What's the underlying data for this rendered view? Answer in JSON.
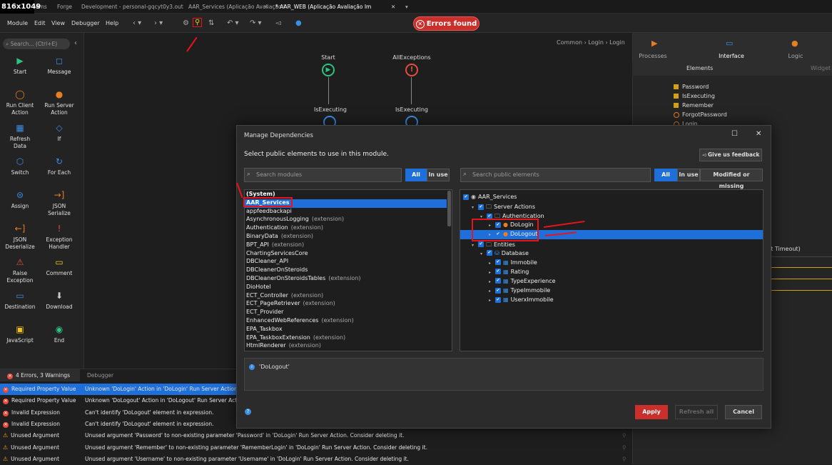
{
  "dims_label": "816x1049",
  "tabs": [
    "ems",
    "Forge",
    "Development - personal-gqcyt0y3.out",
    "AAR_Services (Aplicação Avaliação I",
    "* AAR_WEB (Aplicação Avaliação Im"
  ],
  "menu": [
    "Module",
    "Edit",
    "View",
    "Debugger",
    "Help"
  ],
  "errors_found": "Errors found",
  "search_placeholder": "Search... (Ctrl+E)",
  "breadcrumb": "Common › Login › Login",
  "tools": [
    {
      "label": "Start",
      "icon": "▶",
      "c": ""
    },
    {
      "label": "Message",
      "icon": "◻",
      "c": "b"
    },
    {
      "label": "Run Client\nAction",
      "icon": "◯",
      "c": "o"
    },
    {
      "label": "Run Server\nAction",
      "icon": "●",
      "c": "o"
    },
    {
      "label": "Refresh\nData",
      "icon": "▦",
      "c": "b"
    },
    {
      "label": "If",
      "icon": "◇",
      "c": "b"
    },
    {
      "label": "Switch",
      "icon": "⬡",
      "c": "b"
    },
    {
      "label": "For Each",
      "icon": "↻",
      "c": "b"
    },
    {
      "label": "Assign",
      "icon": "⊜",
      "c": "b"
    },
    {
      "label": "JSON\nSerialize",
      "icon": "→]",
      "c": "o"
    },
    {
      "label": "JSON\nDeserialize",
      "icon": "←]",
      "c": "o"
    },
    {
      "label": "Exception\nHandler",
      "icon": "!",
      "c": "r"
    },
    {
      "label": "Raise\nException",
      "icon": "⚠",
      "c": "r"
    },
    {
      "label": "Comment",
      "icon": "▭",
      "c": "y"
    },
    {
      "label": "Destination",
      "icon": "▭",
      "c": "b"
    },
    {
      "label": "Download",
      "icon": "⬇",
      "c": "w"
    },
    {
      "label": "JavaScript",
      "icon": "▣",
      "c": "y"
    },
    {
      "label": "End",
      "icon": "◉",
      "c": ""
    }
  ],
  "canvas": {
    "start": "Start",
    "allexceptions": "AllExceptions",
    "isexec1": "IsExecuting",
    "isexec2": "IsExecuting"
  },
  "right": {
    "tabs": [
      "Processes",
      "Interface",
      "Logic"
    ],
    "elements": "Elements",
    "widgets": "Widget",
    "items": [
      "Password",
      "IsExecuting",
      "Remember",
      "ForgotPassword",
      "Login"
    ],
    "timeout": "lt Timeout)"
  },
  "errpanel": {
    "tab1": "4 Errors, 3 Warnings",
    "tab2": "Debugger",
    "rows": [
      {
        "type": "error",
        "title": "Required Property Value",
        "msg": "Unknown 'DoLogin' Action in 'DoLogin' Run Server Action."
      },
      {
        "type": "error",
        "title": "Required Property Value",
        "msg": "Unknown 'DoLogout' Action in 'DoLogout' Run Server Acti"
      },
      {
        "type": "error",
        "title": "Invalid Expression",
        "msg": "Can't identify 'DoLogout' element in expression."
      },
      {
        "type": "error",
        "title": "Invalid Expression",
        "msg": "Can't identify 'DoLogout' element in expression."
      },
      {
        "type": "warn",
        "title": "Unused Argument",
        "msg": "Unused argument 'Password' to non-existing parameter 'Password' in 'DoLogin' Run Server Action. Consider deleting it."
      },
      {
        "type": "warn",
        "title": "Unused Argument",
        "msg": "Unused argument 'Remember' to non-existing parameter 'RememberLogin' in 'DoLogin' Run Server Action. Consider deleting it."
      },
      {
        "type": "warn",
        "title": "Unused Argument",
        "msg": "Unused argument 'Username' to non-existing parameter 'Username' in 'DoLogin' Run Server Action. Consider deleting it."
      }
    ]
  },
  "dialog": {
    "title": "Manage Dependencies",
    "subtitle": "Select public elements to use in this module.",
    "feedback": "Give us feedback",
    "search_modules": "Search modules",
    "search_elements": "Search public elements",
    "all": "All",
    "inuse": "In use",
    "modified": "Modified or missing",
    "modules": [
      {
        "name": "(System)",
        "ext": ""
      },
      {
        "name": "AAR_Services",
        "ext": ""
      },
      {
        "name": "appfeedbackapi",
        "ext": ""
      },
      {
        "name": "AsynchronousLogging",
        "ext": "(extension)"
      },
      {
        "name": "Authentication",
        "ext": "(extension)"
      },
      {
        "name": "BinaryData",
        "ext": "(extension)"
      },
      {
        "name": "BPT_API",
        "ext": "(extension)"
      },
      {
        "name": "ChartingServicesCore",
        "ext": ""
      },
      {
        "name": "DBCleaner_API",
        "ext": ""
      },
      {
        "name": "DBCleanerOnSteroids",
        "ext": ""
      },
      {
        "name": "DBCleanerOnSteroidsTables",
        "ext": "(extension)"
      },
      {
        "name": "DioHotel",
        "ext": ""
      },
      {
        "name": "ECT_Controller",
        "ext": "(extension)"
      },
      {
        "name": "ECT_PageRetriever",
        "ext": "(extension)"
      },
      {
        "name": "ECT_Provider",
        "ext": ""
      },
      {
        "name": "EnhancedWebReferences",
        "ext": "(extension)"
      },
      {
        "name": "EPA_Taskbox",
        "ext": ""
      },
      {
        "name": "EPA_TaskboxExtension",
        "ext": "(extension)"
      },
      {
        "name": "HtmlRenderer",
        "ext": "(extension)"
      }
    ],
    "tree": [
      {
        "label": "AAR_Services",
        "level": 0
      },
      {
        "label": "Server Actions",
        "level": 1
      },
      {
        "label": "Authentication",
        "level": 2
      },
      {
        "label": "DoLogin",
        "level": 3
      },
      {
        "label": "DoLogout",
        "level": 3
      },
      {
        "label": "Entities",
        "level": 1
      },
      {
        "label": "Database",
        "level": 2
      },
      {
        "label": "Immobile",
        "level": 3
      },
      {
        "label": "Rating",
        "level": 3
      },
      {
        "label": "TypeExperience",
        "level": 3
      },
      {
        "label": "TypeImmobile",
        "level": 3
      },
      {
        "label": "UserxImmobile",
        "level": 3
      }
    ],
    "info": "'DoLogout'",
    "apply": "Apply",
    "refresh": "Refresh all",
    "cancel": "Cancel"
  }
}
